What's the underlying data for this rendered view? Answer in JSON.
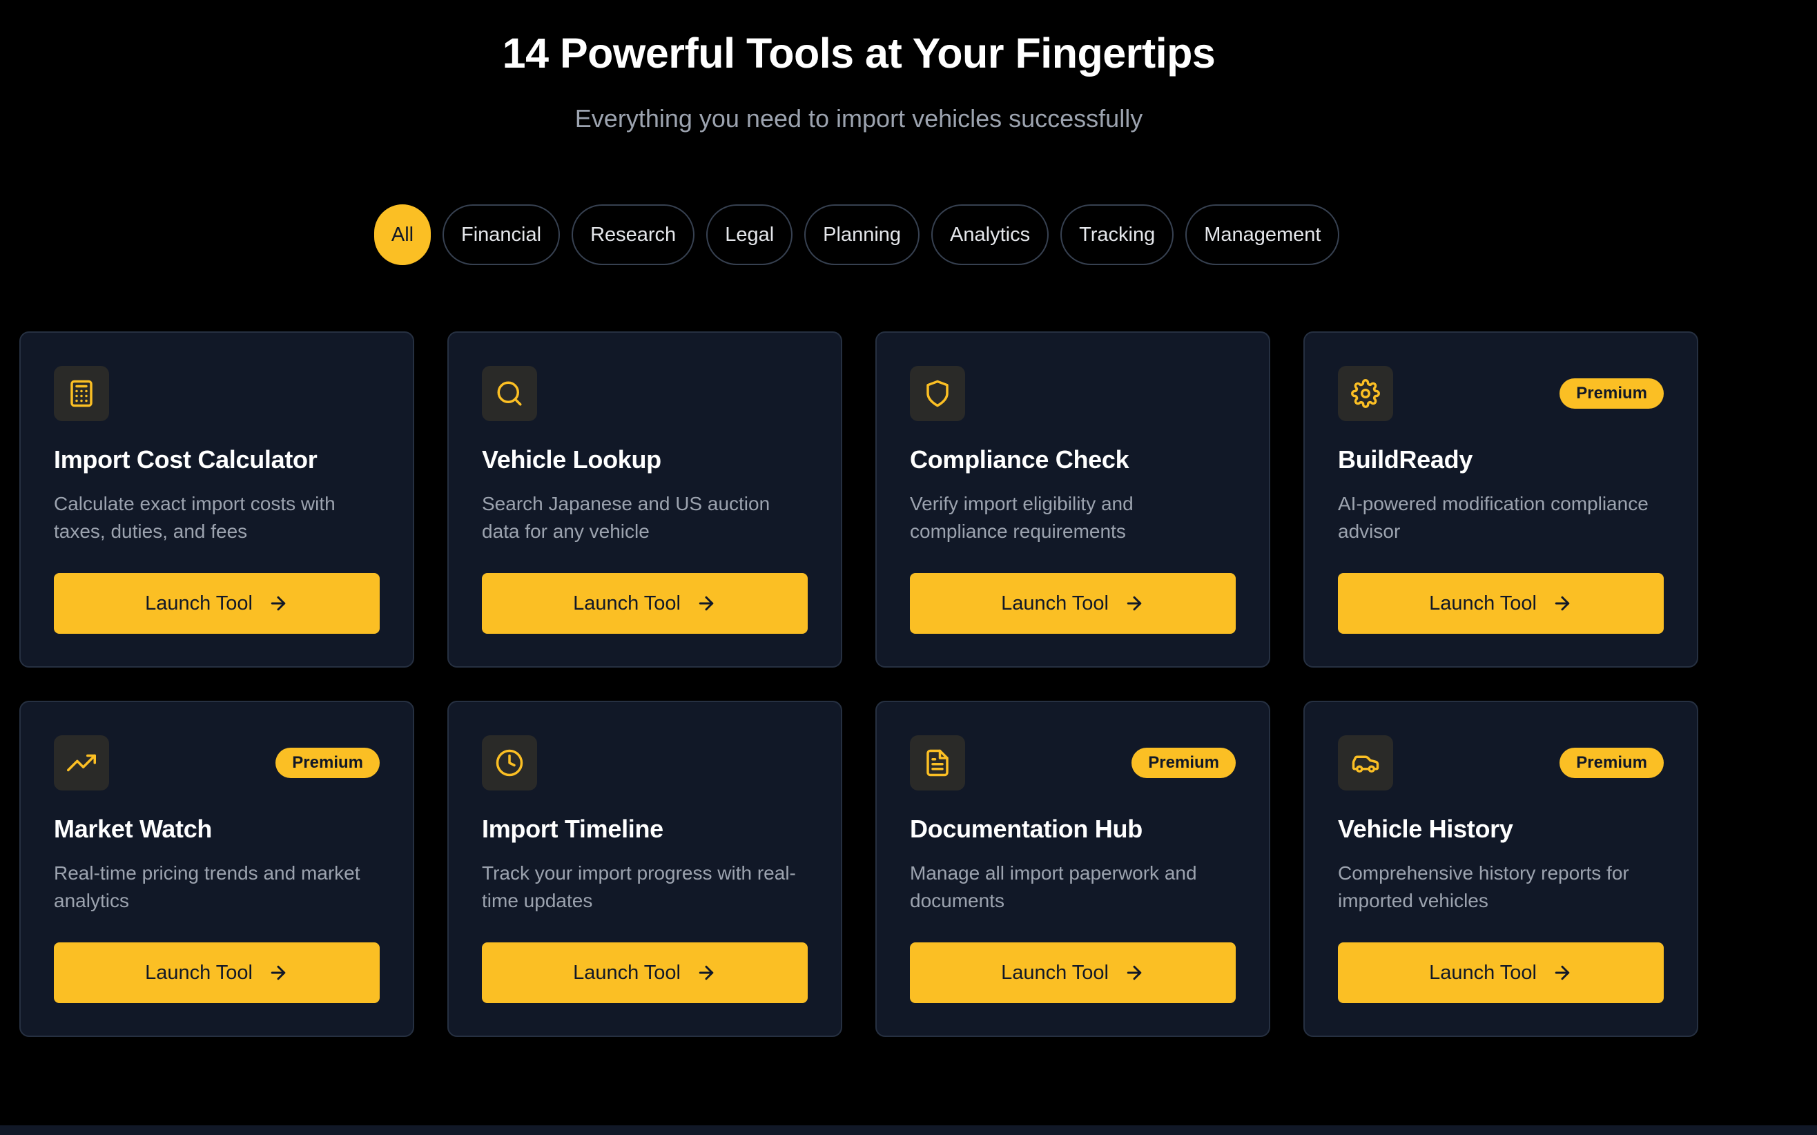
{
  "hero": {
    "title": "14 Powerful Tools at Your Fingertips",
    "subtitle": "Everything you need to import vehicles successfully"
  },
  "filters": [
    "All",
    "Financial",
    "Research",
    "Legal",
    "Planning",
    "Analytics",
    "Tracking",
    "Management"
  ],
  "active_filter": "All",
  "colors": {
    "accent": "#fbbf24",
    "card_bg": "#111827",
    "page_bg": "#000000",
    "muted_text": "#9ca3af"
  },
  "tools": [
    {
      "title": "Import Cost Calculator",
      "description": "Calculate exact import costs with taxes, duties, and fees",
      "icon": "calculator-icon",
      "badge": null,
      "button": "Launch Tool"
    },
    {
      "title": "Vehicle Lookup",
      "description": "Search Japanese and US auction data for any vehicle",
      "icon": "search-icon",
      "badge": null,
      "button": "Launch Tool"
    },
    {
      "title": "Compliance Check",
      "description": "Verify import eligibility and compliance requirements",
      "icon": "shield-icon",
      "badge": null,
      "button": "Launch Tool"
    },
    {
      "title": "BuildReady",
      "description": "AI-powered modification compliance advisor",
      "icon": "gear-icon",
      "badge": "Premium",
      "button": "Launch Tool"
    },
    {
      "title": "Market Watch",
      "description": "Real-time pricing trends and market analytics",
      "icon": "trending-up-icon",
      "badge": "Premium",
      "button": "Launch Tool"
    },
    {
      "title": "Import Timeline",
      "description": "Track your import progress with real-time updates",
      "icon": "clock-icon",
      "badge": null,
      "button": "Launch Tool"
    },
    {
      "title": "Documentation Hub",
      "description": "Manage all import paperwork and documents",
      "icon": "document-icon",
      "badge": "Premium",
      "button": "Launch Tool"
    },
    {
      "title": "Vehicle History",
      "description": "Comprehensive history reports for imported vehicles",
      "icon": "car-icon",
      "badge": "Premium",
      "button": "Launch Tool"
    }
  ]
}
